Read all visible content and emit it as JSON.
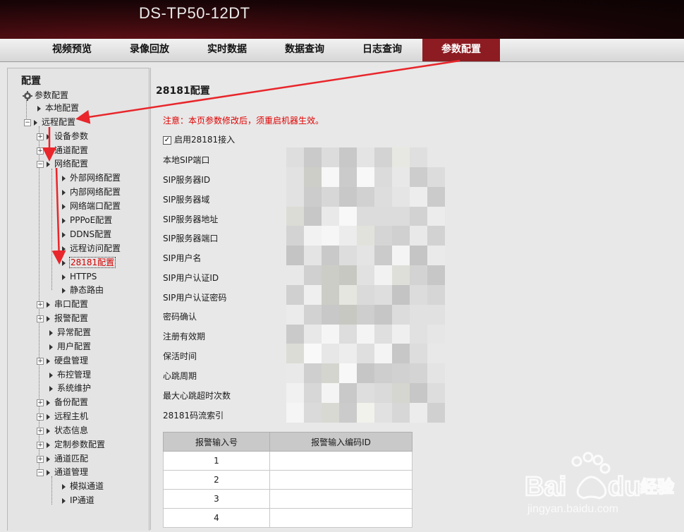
{
  "header": {
    "title": "DS-TP50-12DT"
  },
  "nav": {
    "tabs": [
      {
        "label": "视频预览"
      },
      {
        "label": "录像回放"
      },
      {
        "label": "实时数据"
      },
      {
        "label": "数据查询"
      },
      {
        "label": "日志查询"
      },
      {
        "label": "参数配置",
        "active": true
      }
    ]
  },
  "sidebar": {
    "title": "配置",
    "root": "参数配置",
    "items": [
      {
        "label": "本地配置"
      },
      {
        "label": "远程配置"
      },
      {
        "label": "设备参数"
      },
      {
        "label": "通道配置"
      },
      {
        "label": "网络配置"
      },
      {
        "label": "外部网络配置"
      },
      {
        "label": "内部网络配置"
      },
      {
        "label": "网络端口配置"
      },
      {
        "label": "PPPoE配置"
      },
      {
        "label": "DDNS配置"
      },
      {
        "label": "远程访问配置"
      },
      {
        "label": "28181配置",
        "selected": true
      },
      {
        "label": "HTTPS"
      },
      {
        "label": "静态路由"
      },
      {
        "label": "串口配置"
      },
      {
        "label": "报警配置"
      },
      {
        "label": "异常配置"
      },
      {
        "label": "用户配置"
      },
      {
        "label": "硬盘管理"
      },
      {
        "label": "布控管理"
      },
      {
        "label": "系统维护"
      },
      {
        "label": "备份配置"
      },
      {
        "label": "远程主机"
      },
      {
        "label": "状态信息"
      },
      {
        "label": "定制参数配置"
      },
      {
        "label": "通道匹配"
      },
      {
        "label": "通道管理"
      },
      {
        "label": "模拟通道"
      },
      {
        "label": "IP通道"
      }
    ]
  },
  "main": {
    "title": "28181配置",
    "notice": "注意：本页参数修改后，须重启机器生效。",
    "enable_label": "启用28181接入",
    "enable_checked": true,
    "fields": [
      "本地SIP端口",
      "SIP服务器ID",
      "SIP服务器域",
      "SIP服务器地址",
      "SIP服务器端口",
      "SIP用户名",
      "SIP用户认证ID",
      "SIP用户认证密码",
      "密码确认",
      "注册有效期",
      "保活时间",
      "心跳周期",
      "最大心跳超时次数",
      "28181码流索引"
    ],
    "alarm_table": {
      "headers": [
        "报警输入号",
        "报警输入编码ID"
      ],
      "rows": [
        [
          "1",
          ""
        ],
        [
          "2",
          ""
        ],
        [
          "3",
          ""
        ],
        [
          "4",
          ""
        ]
      ]
    }
  },
  "watermark": {
    "brand": "Bai",
    "brand2": "du",
    "suffix": "经验",
    "url": "jingyan.baidu.com"
  },
  "colors": {
    "accent": "#8c1c22",
    "notice": "#e00000",
    "arrow": "#e8262b"
  }
}
